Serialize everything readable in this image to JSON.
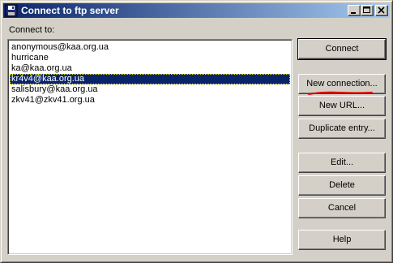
{
  "window": {
    "title": "Connect to ftp server"
  },
  "label": {
    "connect_to": "Connect to:"
  },
  "connections": [
    {
      "text": "anonymous@kaa.org.ua",
      "selected": false
    },
    {
      "text": "hurricane",
      "selected": false
    },
    {
      "text": "ka@kaa.org.ua",
      "selected": false
    },
    {
      "text": "kr4v4@kaa.org.ua",
      "selected": true
    },
    {
      "text": "salisbury@kaa.org.ua",
      "selected": false
    },
    {
      "text": "zkv41@zkv41.org.ua",
      "selected": false
    }
  ],
  "buttons": {
    "connect": "Connect",
    "new_connection": "New connection...",
    "new_url": "New URL...",
    "duplicate": "Duplicate entry...",
    "edit": "Edit...",
    "delete": "Delete",
    "cancel": "Cancel",
    "help": "Help"
  },
  "colors": {
    "titlebar_start": "#0a246a",
    "titlebar_end": "#a6caf0",
    "selection": "#0a246a",
    "annotation": "#e00000"
  }
}
